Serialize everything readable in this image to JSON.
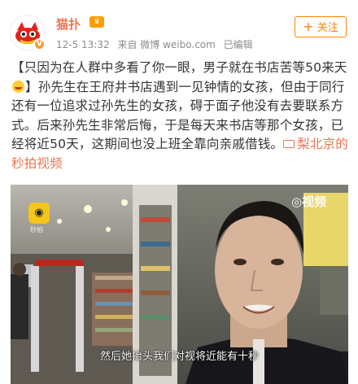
{
  "author": {
    "name": "猫扑",
    "avatar": "cat-mascot-avatar",
    "verified_icon": "verified-v-icon",
    "badge_icon": "vip-badge-icon"
  },
  "meta": {
    "time": "12-5 13:32",
    "source": "来自 微博 weibo.com",
    "edited": "已编辑"
  },
  "follow_button": {
    "label": "关注"
  },
  "post": {
    "part1": "【只因为在人群中多看了你一眼，男子就在书店苦等50来天",
    "part2": "】孙先生在王府井书店遇到一见钟情的女孩，但由于同行还有一位追求过孙先生的女孩，碍于面子他没有去要联系方式。后来孙先生非常后悔，于是每天来书店等那个女孩，已经将近50天，这期间也没上班全靠向亲戚借钱。",
    "video_link": "梨北京的秒拍视频"
  },
  "video": {
    "app_watermark": "秒拍",
    "corner_watermark": "◎视频",
    "subtitle": "然后她抬头我们对视将近能有十秒"
  },
  "colors": {
    "accent": "#eb7350",
    "follow": "#ff8200"
  }
}
